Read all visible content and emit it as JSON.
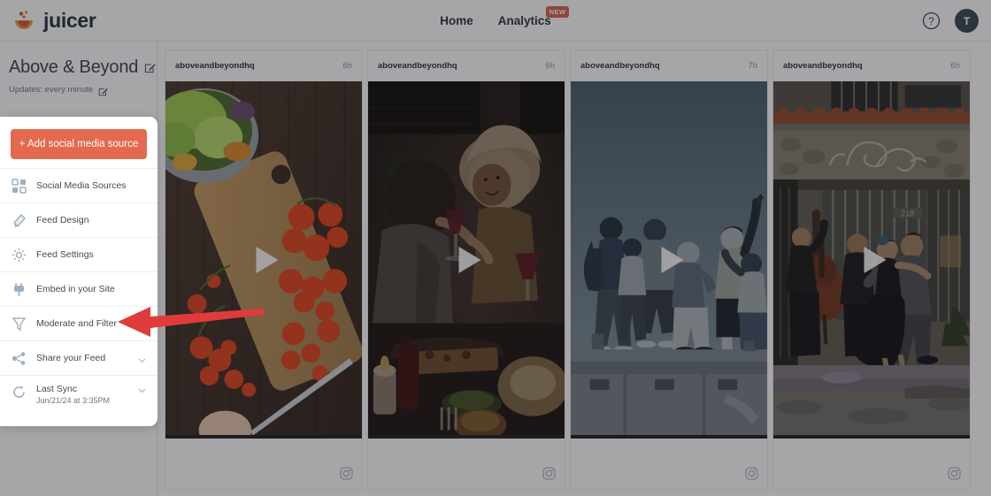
{
  "brand": {
    "name": "juicer",
    "logo_icon": "juicer-splash-logo",
    "accent": "#e3694f"
  },
  "topnav": {
    "links": [
      {
        "label": "Home",
        "badge": null
      },
      {
        "label": "Analytics",
        "badge": "NEW"
      }
    ],
    "help_icon": "question-circle-icon",
    "avatar_initial": "T"
  },
  "sidebar": {
    "feed_title": "Above & Beyond",
    "feed_title_edit_icon": "edit-pencil-icon",
    "updates_label": "Updates: every minute",
    "updates_edit_icon": "edit-pencil-icon",
    "add_source_label": "+ Add social media source",
    "items": [
      {
        "label": "Social Media Sources",
        "icon": "grid-squares-icon",
        "chevron": false,
        "sub": null
      },
      {
        "label": "Feed Design",
        "icon": "paint-roller-icon",
        "chevron": false,
        "sub": null
      },
      {
        "label": "Feed Settings",
        "icon": "gear-icon",
        "chevron": false,
        "sub": null
      },
      {
        "label": "Embed in your Site",
        "icon": "plug-icon",
        "chevron": false,
        "sub": null
      },
      {
        "label": "Moderate and Filter",
        "icon": "funnel-filter-icon",
        "chevron": false,
        "sub": null
      },
      {
        "label": "Share your Feed",
        "icon": "share-nodes-icon",
        "chevron": true,
        "sub": null
      },
      {
        "label": "Last Sync",
        "icon": "refresh-sync-icon",
        "chevron": true,
        "sub": "Jun/21/24 at 3:35PM"
      }
    ]
  },
  "annotation": {
    "type": "arrow",
    "color": "#e03b3b",
    "points_to": "Moderate and Filter",
    "direction": "left"
  },
  "feed": {
    "source_icon": "instagram-icon",
    "play_icon": "play-triangle-icon",
    "cards": [
      {
        "username": "aboveandbeyondhq",
        "time": "6h",
        "media_kind": "video",
        "media_description": "salad bowl with lettuce and cherry tomatoes on a wooden cutting board with a knife"
      },
      {
        "username": "aboveandbeyondhq",
        "time": "6h",
        "media_kind": "video",
        "media_description": "dim candlelit dinner, smiling woman with curly blonde hair holding a glass of red wine"
      },
      {
        "username": "aboveandbeyondhq",
        "time": "7h",
        "media_kind": "video",
        "media_description": "group of friends celebrating on a rooftop against a pale blue sky"
      },
      {
        "username": "aboveandbeyondhq",
        "time": "6h",
        "media_kind": "video",
        "media_description": "tango dancers outside a building with a double-bass musician and terracotta roof tiles"
      }
    ]
  }
}
